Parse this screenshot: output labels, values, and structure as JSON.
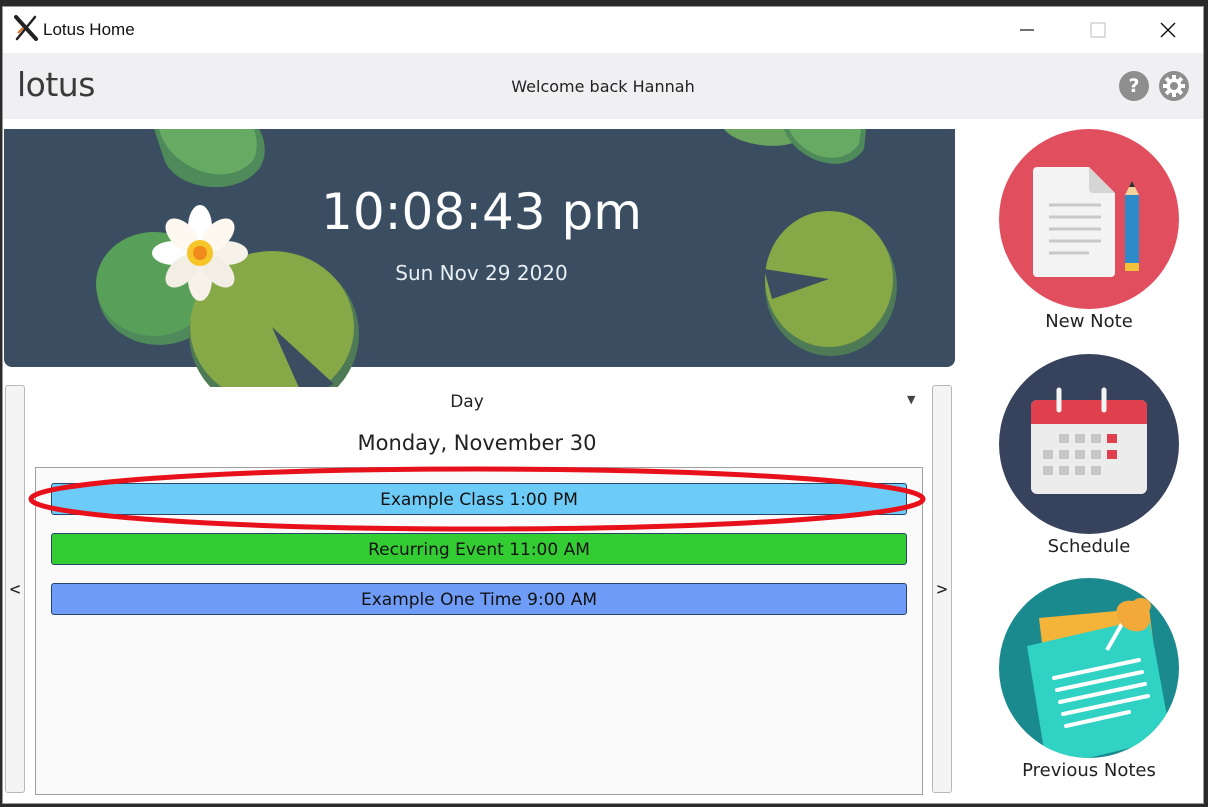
{
  "window": {
    "title": "Lotus Home",
    "controls": {
      "minimize": "minimize-icon",
      "maximize": "maximize-icon",
      "close": "close-icon"
    }
  },
  "header": {
    "brand": "lotus",
    "welcome": "Welcome back Hannah",
    "help_label": "?",
    "settings_icon": "gear-icon"
  },
  "banner": {
    "time": "10:08:43 pm",
    "date": "Sun Nov 29 2020"
  },
  "calendar": {
    "view": "Day",
    "prev_label": "<",
    "next_label": ">",
    "day_heading": "Monday, November 30",
    "events": [
      {
        "label": "Example Class 1:00 PM",
        "color": "#6dccf7"
      },
      {
        "label": "Recurring Event 11:00 AM",
        "color": "#33cc33"
      },
      {
        "label": "Example One Time 9:00 AM",
        "color": "#6e9cf7"
      }
    ]
  },
  "tiles": [
    {
      "label": "New Note",
      "icon": "new-note-icon",
      "color": "#e14f5f"
    },
    {
      "label": "Schedule",
      "icon": "calendar-icon",
      "color": "#37425d"
    },
    {
      "label": "Previous Notes",
      "icon": "sticky-notes-icon",
      "color": "#1b8a8f"
    }
  ],
  "colors": {
    "banner_bg": "#3b4e61",
    "annotation": "#e8101a"
  }
}
